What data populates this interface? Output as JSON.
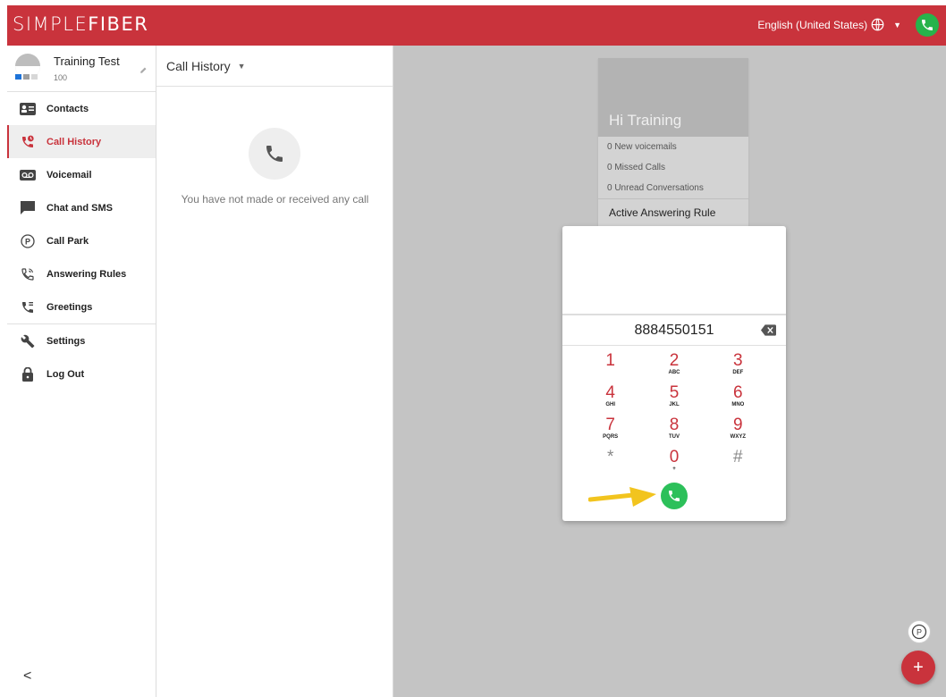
{
  "header": {
    "brand_part1": "SIMPLE",
    "brand_part2": "FIBER",
    "language": "English (United States)",
    "brand_color": "#c9333c"
  },
  "profile": {
    "name": "Training Test",
    "extension": "100"
  },
  "sidebar": {
    "items": [
      {
        "label": "Contacts",
        "icon": "contacts-icon"
      },
      {
        "label": "Call History",
        "icon": "call-history-icon",
        "active": true
      },
      {
        "label": "Voicemail",
        "icon": "voicemail-icon"
      },
      {
        "label": "Chat and SMS",
        "icon": "chat-icon"
      },
      {
        "label": "Call Park",
        "icon": "call-park-icon"
      },
      {
        "label": "Answering Rules",
        "icon": "answering-rules-icon"
      },
      {
        "label": "Greetings",
        "icon": "greetings-icon"
      },
      {
        "label": "Settings",
        "icon": "wrench-icon"
      },
      {
        "label": "Log Out",
        "icon": "lock-icon"
      }
    ],
    "collapse_glyph": "<"
  },
  "history": {
    "title": "Call History",
    "empty_message": "You have not made or received any call"
  },
  "welcome": {
    "title": "Hi Training",
    "lines": [
      "0 New voicemails",
      "0 Missed Calls",
      "0 Unread Conversations"
    ],
    "rule_heading": "Active Answering Rule"
  },
  "dialer": {
    "number": "8884550151",
    "keys": [
      {
        "d": "1",
        "l": ""
      },
      {
        "d": "2",
        "l": "ABC"
      },
      {
        "d": "3",
        "l": "DEF"
      },
      {
        "d": "4",
        "l": "GHI"
      },
      {
        "d": "5",
        "l": "JKL"
      },
      {
        "d": "6",
        "l": "MNO"
      },
      {
        "d": "7",
        "l": "PQRS"
      },
      {
        "d": "8",
        "l": "TUV"
      },
      {
        "d": "9",
        "l": "WXYZ"
      },
      {
        "d": "*",
        "l": ""
      },
      {
        "d": "0",
        "l": "+"
      },
      {
        "d": "#",
        "l": ""
      }
    ]
  },
  "fab": {
    "add_glyph": "+",
    "park_glyph": "P"
  }
}
